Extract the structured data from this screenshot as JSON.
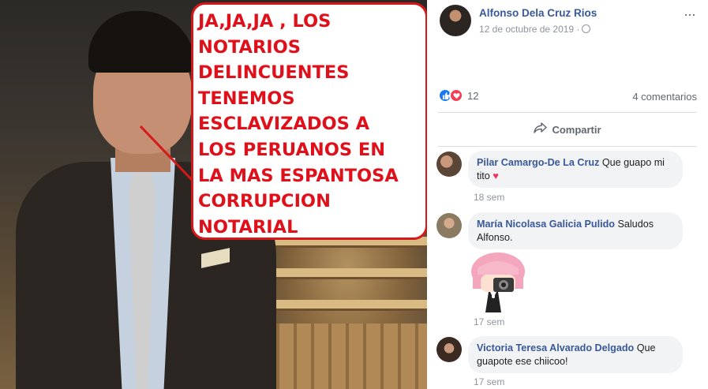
{
  "caption": {
    "lines": [
      "JA,JA,JA , LOS",
      "NOTARIOS",
      "DELINCUENTES",
      "TENEMOS",
      "ESCLAVIZADOS A",
      "LOS PERUANOS EN",
      "LA MAS ESPANTOSA",
      "CORRUPCION",
      "NOTARIAL"
    ],
    "color": "#e0101b"
  },
  "post": {
    "author": "Alfonso Dela Cruz Rios",
    "date": "12 de octubre de 2019 ·",
    "privacy_icon": "globe-icon",
    "menu": "···",
    "reactions_count": "12",
    "comments_count": "4 comentarios",
    "share_label": "Compartir",
    "share_icon": "share-arrow-icon"
  },
  "comments": [
    {
      "name": "Pilar Camargo-De La Cruz",
      "text": " Que guapo mi tito ",
      "emoji": "♥",
      "time": "18 sem"
    },
    {
      "name": "María Nicolasa Galicia Pulido",
      "text": " Saludos Alfonso.",
      "time": "17 sem",
      "sticker": "photographer-girl-sticker"
    },
    {
      "name": "Victoria Teresa Alvarado Delgado",
      "text": " Que guapote ese chiicoo!",
      "time": "17 sem"
    }
  ],
  "colors": {
    "link_blue": "#385898",
    "meta_gray": "#90949c",
    "like_blue": "#1877f2",
    "love_red": "#f33e58",
    "bubble_bg": "#f2f3f5"
  }
}
